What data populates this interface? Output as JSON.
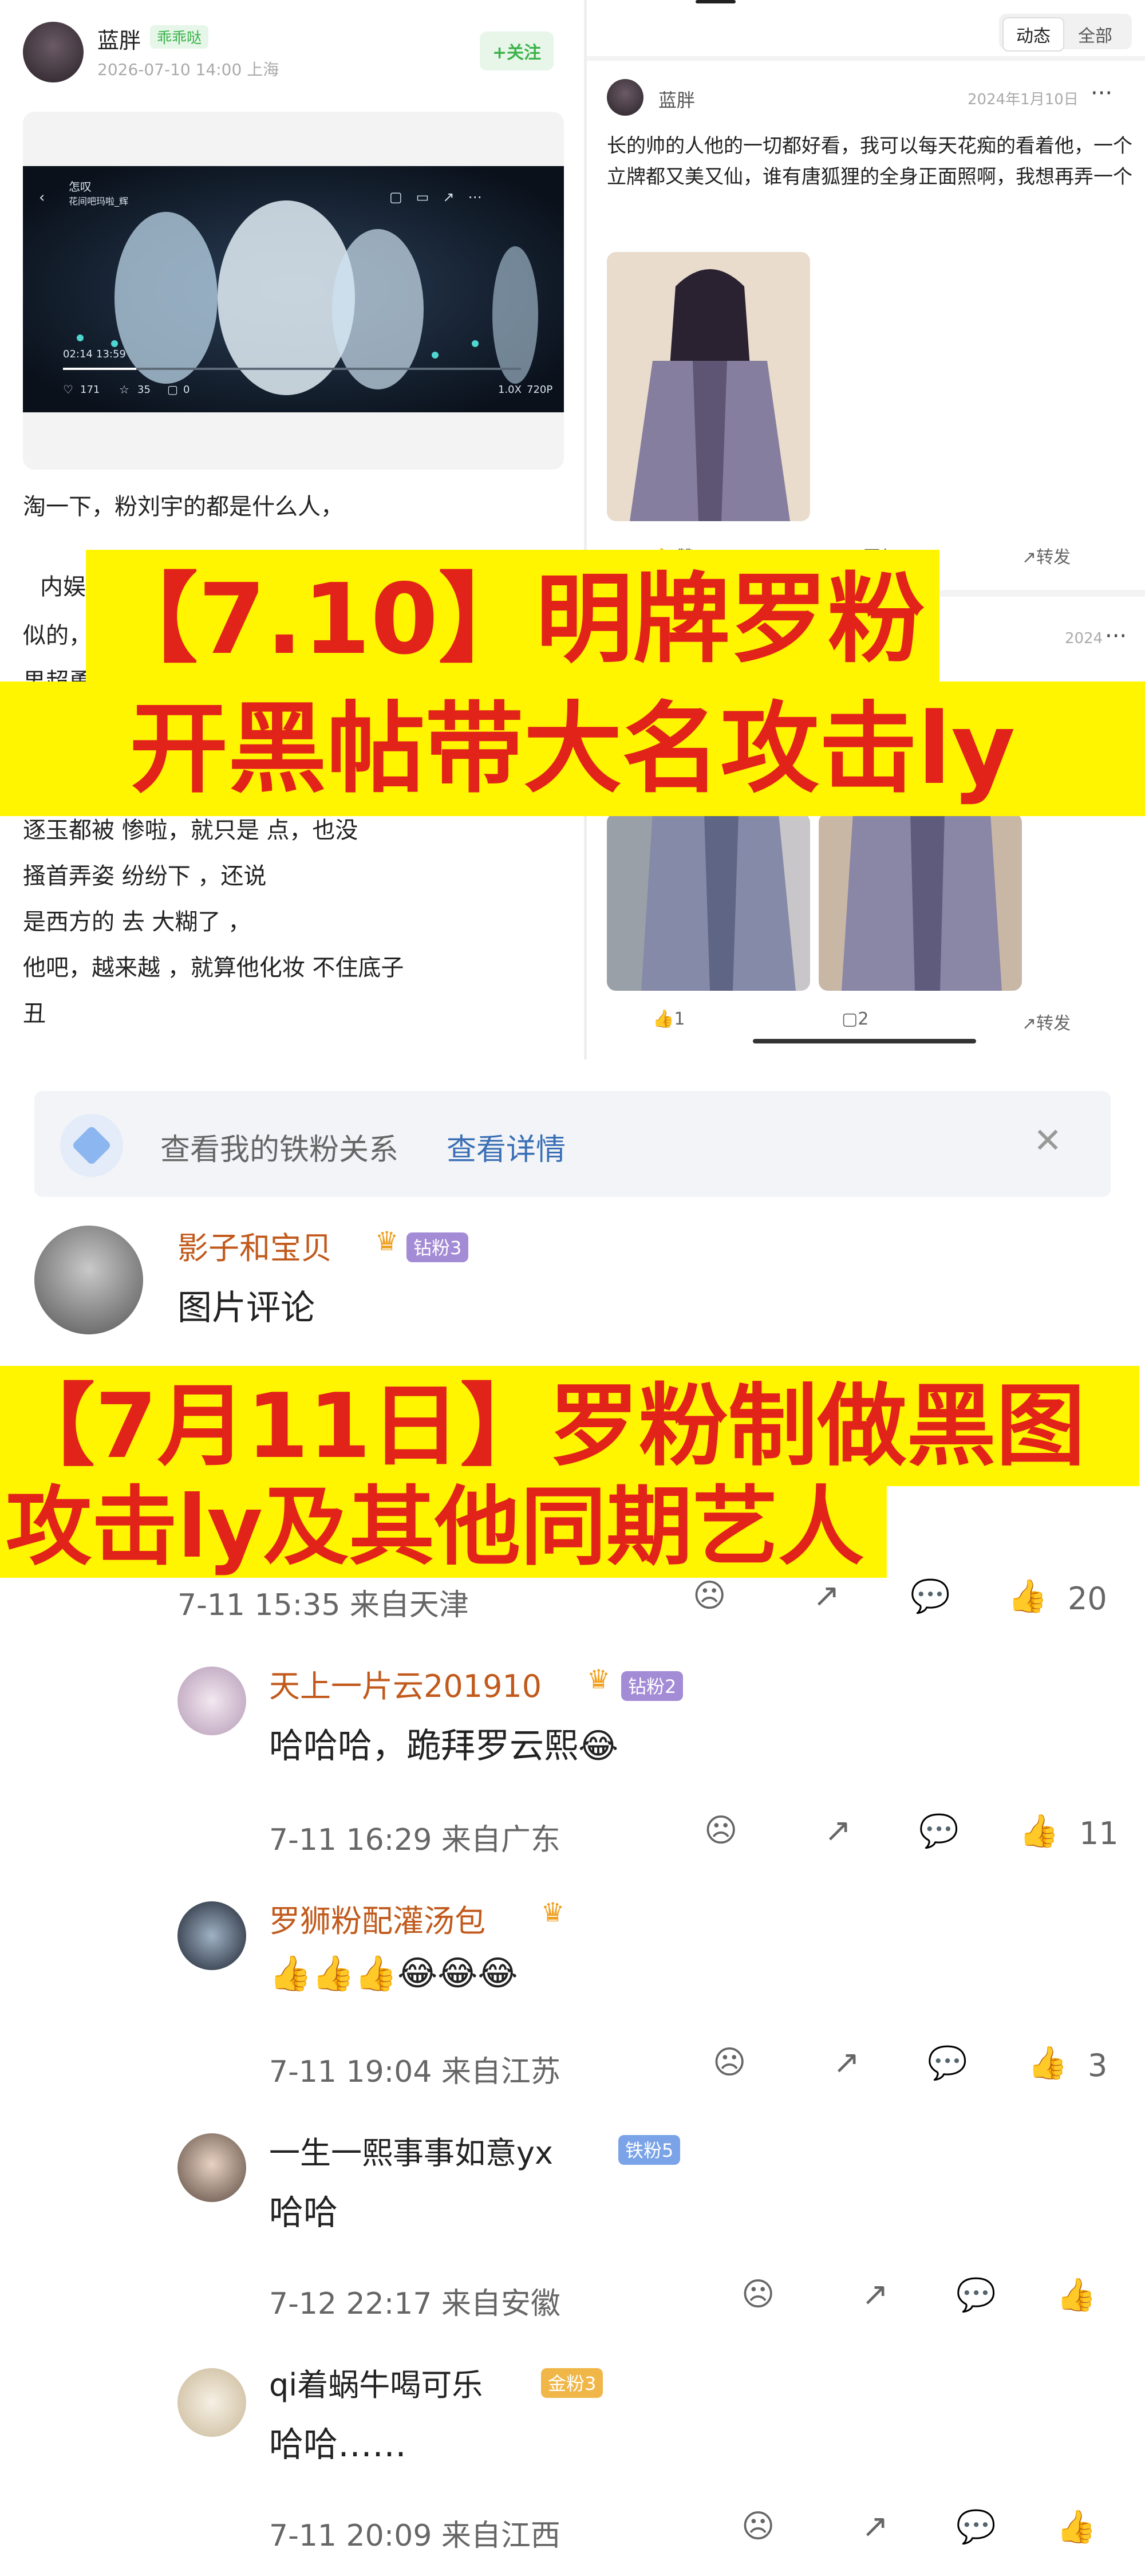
{
  "left_post": {
    "user_name": "蓝胖",
    "level": "乖乖哒",
    "time_location": "2026-07-10 14:00 上海",
    "follow_label": "+关注",
    "video": {
      "title": "怎叹",
      "subtitle": "花间吧玛啦_辉",
      "current_time": "02:14",
      "duration": "13:59",
      "likes": "171",
      "favorites": "35",
      "comments": "0",
      "speed": "1.0X",
      "quality": "720P"
    },
    "text_line1": "淘一下，粉刘宇的都是什么人，",
    "text_line2": "内娱",
    "text_line3": "似的，",
    "text_line4": "男超勇",
    "text_line5": "逐玉都被 惨啦，就只是 点，也没",
    "text_line6": "搔首弄姿 纷纷下 ，还说",
    "text_line7": "是西方的 去 大糊了 ，",
    "text_line8": "他吧，越来越 ，就算他化妆 不住底子",
    "text_line9": "丑"
  },
  "right_feed": {
    "tab_active": "动态",
    "tab_all": "全部",
    "post1": {
      "user_name": "蓝胖",
      "date": "2024年1月10日",
      "more": "···",
      "text": "长的帅的人他的一切都好看，我可以每天花痴的看着他，一个立牌都又美又仙，谁有唐狐狸的全身正面照啊，我想再弄一个",
      "like_label": "赞",
      "comment_label": "回复",
      "share_label": "转发"
    },
    "post2": {
      "date": "2024",
      "more": "···",
      "likes": "1",
      "comments": "2",
      "share_label": "转发"
    }
  },
  "banners": {
    "b1_line1": "【7.10】明牌罗粉",
    "b1_line2": "开黑帖带大名攻击ly",
    "b2_line1": "【7月11日】罗粉制做黑图",
    "b2_line2": "攻击ly及其他同期艺人"
  },
  "comments": {
    "fan_bar": {
      "text": "查看我的铁粉关系",
      "link": "查看详情",
      "close": "✕"
    },
    "c1": {
      "name": "影子和宝贝",
      "badge": "钻粉3",
      "text": "图片评论",
      "meta": "7-11 15:35  来自天津",
      "likes": "20"
    },
    "c2": {
      "name": "天上一片云201910",
      "badge": "钻粉2",
      "text": "哈哈哈，跪拜罗云熙😂",
      "meta": "7-11 16:29  来自广东",
      "likes": "11"
    },
    "c3": {
      "name": "罗狮粉配灌汤包",
      "text": "👍👍👍😂😂😂",
      "meta": "7-11 19:04  来自江苏",
      "likes": "3"
    },
    "c4": {
      "name": "一生一熙事事如意yx",
      "badge": "铁粉5",
      "text": "哈哈",
      "meta": "7-12 22:17  来自安徽"
    },
    "c5": {
      "name": "qi着蜗牛喝可乐",
      "badge": "金粉3",
      "text": "哈哈……",
      "meta": "7-11 20:09  来自江西"
    }
  },
  "icons": {
    "like": "thumbs-up-icon",
    "comment": "comment-icon",
    "share": "share-icon",
    "dislike": "sad-face-icon",
    "crown": "crown-icon",
    "close": "close-icon",
    "diamond": "diamond-icon"
  },
  "colors": {
    "banner_bg": "#fff500",
    "banner_text": "#e2231a",
    "name_orange": "#c15a1c",
    "follow_green": "#3bb34a",
    "link_blue": "#3b6fb5"
  }
}
